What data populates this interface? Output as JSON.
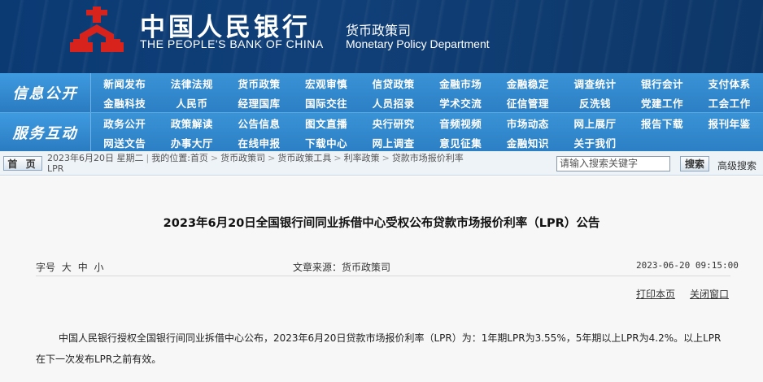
{
  "header": {
    "bank_name_cn": "中国人民银行",
    "bank_name_en": "THE PEOPLE'S BANK OF CHINA",
    "dept_cn": "货币政策司",
    "dept_en": "Monetary Policy Department",
    "emblem_color": "#d7231c"
  },
  "nav": {
    "sections": [
      {
        "category": "信息公开",
        "rows": [
          [
            "新闻发布",
            "法律法规",
            "货币政策",
            "宏观审慎",
            "信贷政策",
            "金融市场",
            "金融稳定",
            "调查统计",
            "银行会计",
            "支付体系"
          ],
          [
            "金融科技",
            "人民币",
            "经理国库",
            "国际交往",
            "人员招录",
            "学术交流",
            "征信管理",
            "反洗钱",
            "党建工作",
            "工会工作"
          ]
        ]
      },
      {
        "category": "服务互动",
        "rows": [
          [
            "政务公开",
            "政策解读",
            "公告信息",
            "图文直播",
            "央行研究",
            "音频视频",
            "市场动态",
            "网上展厅",
            "报告下载",
            "报刊年鉴"
          ],
          [
            "网送文告",
            "办事大厅",
            "在线申报",
            "下载中心",
            "网上调查",
            "意见征集",
            "金融知识",
            "关于我们"
          ]
        ]
      }
    ]
  },
  "crumbbar": {
    "home_label": "首 页",
    "date": "2023年6月20日 星期二",
    "location_label": "我的位置:",
    "crumbs": [
      "首页",
      "货币政策司",
      "货币政策工具",
      "利率政策",
      "贷款市场报价利率",
      "LPR"
    ],
    "search_placeholder": "请输入搜索关键字",
    "search_button": "搜索",
    "advanced_search": "高级搜索"
  },
  "article": {
    "title": "2023年6月20日全国银行间同业拆借中心受权公布贷款市场报价利率（LPR）公告",
    "font_size_label": "字号",
    "font_sizes": [
      "大",
      "中",
      "小"
    ],
    "source": "文章来源：货币政策司",
    "datetime": "2023-06-20 09:15:00",
    "print_label": "打印本页",
    "close_label": "关闭窗口",
    "body": "中国人民银行授权全国银行间同业拆借中心公布，2023年6月20日贷款市场报价利率（LPR）为：1年期LPR为3.55%，5年期以上LPR为4.2%。以上LPR在下一次发布LPR之前有效。"
  }
}
